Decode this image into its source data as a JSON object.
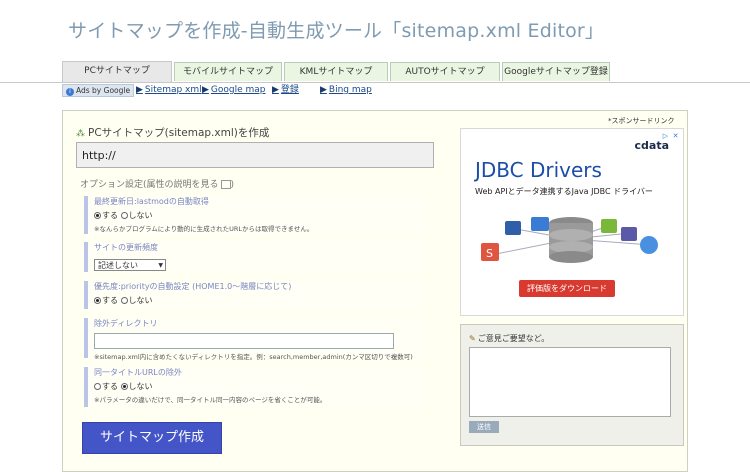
{
  "page_title": "サイトマップを作成-自動生成ツール「sitemap.xml Editor」",
  "tabs": [
    {
      "label": "PCサイトマップ"
    },
    {
      "label": "モバイルサイトマップ"
    },
    {
      "label": "KMLサイトマップ"
    },
    {
      "label": "AUTOサイトマップ"
    },
    {
      "label": "Googleサイトマップ登録"
    }
  ],
  "subnav": {
    "ads_label": "Ads by Google",
    "links": [
      {
        "label": "Sitemap xml"
      },
      {
        "label": "Google map"
      },
      {
        "label": "登録"
      },
      {
        "label": "Bing map"
      }
    ]
  },
  "sponsor_label": "*スポンサードリンク",
  "form": {
    "title": "PCサイトマップ(sitemap.xml)を作成",
    "url_value": "http://",
    "options_link": "オプション設定(属性の説明を見る",
    "sections": {
      "lastmod": {
        "head": "最終更新日:lastmodの自動取得",
        "yes": "する",
        "no": "しない",
        "note": "※なんらかプログラムにより動的に生成されたURLからは取得できません。"
      },
      "changefreq": {
        "head": "サイトの更新頻度",
        "selected": "記述しない"
      },
      "priority": {
        "head": "優先度:priorityの自動設定 (HOME1.0〜階層に応じて)",
        "yes": "する",
        "no": "しない"
      },
      "exclude": {
        "head": "除外ディレクトリ",
        "note": "※sitemap.xml内に含めたくないディレクトリを指定。例：search,member,admin(カンマ区切りで複数可)"
      },
      "dup": {
        "head": "同一タイトルURLの除外",
        "yes": "する",
        "no": "しない",
        "note": "※パラメータの違いだけで、同一タイトル同一内容のページを省くことが可能。"
      }
    },
    "submit_label": "サイトマップ作成"
  },
  "ad": {
    "brand": "cdata",
    "headline": "JDBC Drivers",
    "subline": "Web APIとデータ連携するJava JDBC ドライバー",
    "cta": "評価版をダウンロード",
    "colors": {
      "accent": "#1a4ea8",
      "cta": "#d93a30"
    }
  },
  "comment_box": {
    "label": "ご意見ご要望など。",
    "send_label": "送信"
  }
}
